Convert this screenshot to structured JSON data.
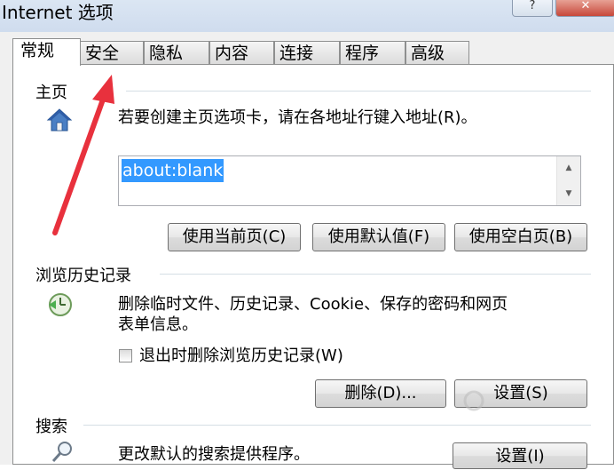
{
  "window": {
    "title": "Internet 选项",
    "help_label": "?",
    "close_label": "✕"
  },
  "tabs": [
    {
      "label": "常规",
      "active": true
    },
    {
      "label": "安全",
      "active": false
    },
    {
      "label": "隐私",
      "active": false
    },
    {
      "label": "内容",
      "active": false
    },
    {
      "label": "连接",
      "active": false
    },
    {
      "label": "程序",
      "active": false
    },
    {
      "label": "高级",
      "active": false
    }
  ],
  "homepage": {
    "title": "主页",
    "icon": "home-icon",
    "instruction": "若要创建主页选项卡，请在各地址行键入地址(R)。",
    "url_value": "about:blank",
    "use_current_label": "使用当前页(C)",
    "use_default_label": "使用默认值(F)",
    "use_blank_label": "使用空白页(B)"
  },
  "history": {
    "title": "浏览历史记录",
    "icon": "history-clock-icon",
    "description_line1": "删除临时文件、历史记录、Cookie、保存的密码和网页",
    "description_line2": "表单信息。",
    "checkbox_label": "退出时删除浏览历史记录(W)",
    "checkbox_checked": false,
    "delete_label": "删除(D)...",
    "settings_label": "设置(S)"
  },
  "search": {
    "title": "搜索",
    "icon": "search-icon",
    "description": "更改默认的搜索提供程序。",
    "settings_label": "设置(I)"
  },
  "colors": {
    "selection": "#3399ff",
    "annotation_arrow": "#e8313d",
    "panel_border": "#8e8f8f"
  }
}
